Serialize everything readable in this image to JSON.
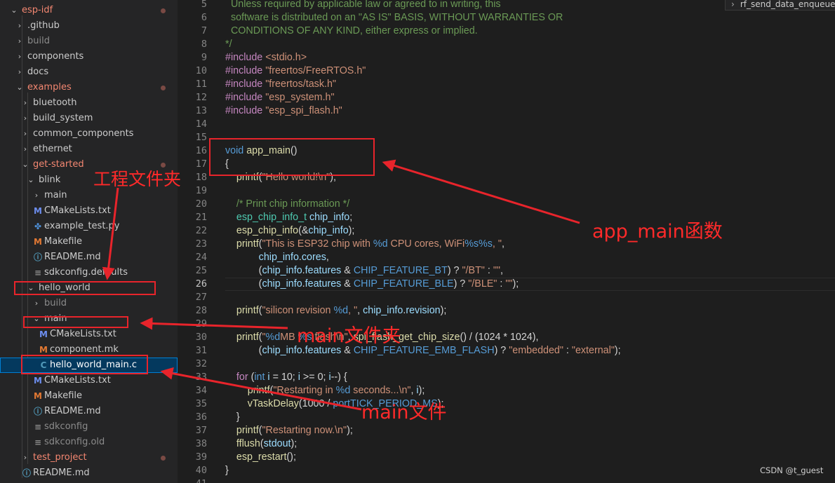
{
  "explorer": {
    "rows": [
      {
        "label": "esp-idf",
        "chevron": "⌄",
        "icon": "",
        "color": "#f48771",
        "modified": true,
        "indent": 0
      },
      {
        "label": ".github",
        "chevron": "›",
        "icon": "",
        "color": "#cccccc",
        "modified": false,
        "indent": 1
      },
      {
        "label": "build",
        "chevron": "›",
        "icon": "",
        "color": "#8b8b8b",
        "modified": false,
        "indent": 1
      },
      {
        "label": "components",
        "chevron": "›",
        "icon": "",
        "color": "#cccccc",
        "modified": false,
        "indent": 1
      },
      {
        "label": "docs",
        "chevron": "›",
        "icon": "",
        "color": "#cccccc",
        "modified": false,
        "indent": 1
      },
      {
        "label": "examples",
        "chevron": "⌄",
        "icon": "",
        "color": "#f48771",
        "modified": true,
        "indent": 1
      },
      {
        "label": "bluetooth",
        "chevron": "›",
        "icon": "",
        "color": "#cccccc",
        "modified": false,
        "indent": 2
      },
      {
        "label": "build_system",
        "chevron": "›",
        "icon": "",
        "color": "#cccccc",
        "modified": false,
        "indent": 2
      },
      {
        "label": "common_components",
        "chevron": "›",
        "icon": "",
        "color": "#cccccc",
        "modified": false,
        "indent": 2
      },
      {
        "label": "ethernet",
        "chevron": "›",
        "icon": "",
        "color": "#cccccc",
        "modified": false,
        "indent": 2
      },
      {
        "label": "get-started",
        "chevron": "⌄",
        "icon": "",
        "color": "#f48771",
        "modified": true,
        "indent": 2
      },
      {
        "label": "blink",
        "chevron": "⌄",
        "icon": "",
        "color": "#cccccc",
        "modified": false,
        "indent": 3
      },
      {
        "label": "main",
        "chevron": "›",
        "icon": "",
        "color": "#cccccc",
        "modified": false,
        "indent": 4
      },
      {
        "label": "CMakeLists.txt",
        "chevron": "",
        "icon": "M",
        "iconColor": "#6d8ef0",
        "color": "#cccccc",
        "modified": false,
        "indent": 4
      },
      {
        "label": "example_test.py",
        "chevron": "",
        "icon": "✤",
        "iconColor": "#4e8fd6",
        "color": "#cccccc",
        "modified": false,
        "indent": 4
      },
      {
        "label": "Makefile",
        "chevron": "",
        "icon": "M",
        "iconColor": "#e37933",
        "color": "#cccccc",
        "modified": false,
        "indent": 4
      },
      {
        "label": "README.md",
        "chevron": "",
        "icon": "ⓘ",
        "iconColor": "#519aba",
        "color": "#cccccc",
        "modified": false,
        "indent": 4
      },
      {
        "label": "sdkconfig.defaults",
        "chevron": "",
        "icon": "≡",
        "iconColor": "#8b8b8b",
        "color": "#cccccc",
        "modified": false,
        "indent": 4
      },
      {
        "label": "hello_world",
        "chevron": "⌄",
        "icon": "",
        "color": "#cccccc",
        "modified": false,
        "indent": 3
      },
      {
        "label": "build",
        "chevron": "›",
        "icon": "",
        "color": "#8b8b8b",
        "modified": false,
        "indent": 4
      },
      {
        "label": "main",
        "chevron": "⌄",
        "icon": "",
        "color": "#cccccc",
        "modified": false,
        "indent": 4
      },
      {
        "label": "CMakeLists.txt",
        "chevron": "",
        "icon": "M",
        "iconColor": "#6d8ef0",
        "color": "#cccccc",
        "modified": false,
        "indent": 5
      },
      {
        "label": "component.mk",
        "chevron": "",
        "icon": "M",
        "iconColor": "#e37933",
        "color": "#cccccc",
        "modified": false,
        "indent": 5
      },
      {
        "label": "hello_world_main.c",
        "chevron": "",
        "icon": "C",
        "iconColor": "#519aba",
        "color": "#ffffff",
        "modified": false,
        "indent": 5,
        "selected": true
      },
      {
        "label": "CMakeLists.txt",
        "chevron": "",
        "icon": "M",
        "iconColor": "#6d8ef0",
        "color": "#cccccc",
        "modified": false,
        "indent": 4
      },
      {
        "label": "Makefile",
        "chevron": "",
        "icon": "M",
        "iconColor": "#e37933",
        "color": "#cccccc",
        "modified": false,
        "indent": 4
      },
      {
        "label": "README.md",
        "chevron": "",
        "icon": "ⓘ",
        "iconColor": "#519aba",
        "color": "#cccccc",
        "modified": false,
        "indent": 4
      },
      {
        "label": "sdkconfig",
        "chevron": "",
        "icon": "≡",
        "iconColor": "#8b8b8b",
        "color": "#8b8b8b",
        "modified": false,
        "indent": 4
      },
      {
        "label": "sdkconfig.old",
        "chevron": "",
        "icon": "≡",
        "iconColor": "#8b8b8b",
        "color": "#8b8b8b",
        "modified": false,
        "indent": 4
      },
      {
        "label": "test_project",
        "chevron": "›",
        "icon": "",
        "color": "#f48771",
        "modified": true,
        "indent": 2
      },
      {
        "label": "README.md",
        "chevron": "",
        "icon": "ⓘ",
        "iconColor": "#519aba",
        "color": "#cccccc",
        "modified": false,
        "indent": 2
      }
    ]
  },
  "breadcrumb": {
    "label": "rf_send_data_enqueue"
  },
  "editor": {
    "current_line": 26,
    "lines": [
      {
        "n": 5,
        "tokens": [
          [
            "  Unless required by applicable law or agreed to in writing, this",
            "#6a9955"
          ]
        ]
      },
      {
        "n": 6,
        "tokens": [
          [
            "  software is distributed on an \"AS IS\" BASIS, WITHOUT WARRANTIES OR",
            "#6a9955"
          ]
        ]
      },
      {
        "n": 7,
        "tokens": [
          [
            "  CONDITIONS OF ANY KIND, either express or implied.",
            "#6a9955"
          ]
        ]
      },
      {
        "n": 8,
        "tokens": [
          [
            "*/",
            "#6a9955"
          ]
        ]
      },
      {
        "n": 9,
        "tokens": [
          [
            "#include ",
            "#c586c0"
          ],
          [
            "<stdio.h>",
            "#ce9178"
          ]
        ]
      },
      {
        "n": 10,
        "tokens": [
          [
            "#include ",
            "#c586c0"
          ],
          [
            "\"freertos/FreeRTOS.h\"",
            "#ce9178"
          ]
        ]
      },
      {
        "n": 11,
        "tokens": [
          [
            "#include ",
            "#c586c0"
          ],
          [
            "\"freertos/task.h\"",
            "#ce9178"
          ]
        ]
      },
      {
        "n": 12,
        "tokens": [
          [
            "#include ",
            "#c586c0"
          ],
          [
            "\"esp_system.h\"",
            "#ce9178"
          ]
        ]
      },
      {
        "n": 13,
        "tokens": [
          [
            "#include ",
            "#c586c0"
          ],
          [
            "\"esp_spi_flash.h\"",
            "#ce9178"
          ]
        ]
      },
      {
        "n": 14,
        "tokens": []
      },
      {
        "n": 15,
        "tokens": []
      },
      {
        "n": 16,
        "tokens": [
          [
            "void ",
            "#569cd6"
          ],
          [
            "app_main",
            "#dcdcaa"
          ],
          [
            "()",
            "#d4d4d4"
          ]
        ]
      },
      {
        "n": 17,
        "tokens": [
          [
            "{",
            "#d4d4d4"
          ]
        ]
      },
      {
        "n": 18,
        "tokens": [
          [
            "    ",
            "#d4d4d4"
          ],
          [
            "printf",
            "#dcdcaa"
          ],
          [
            "(",
            "#d4d4d4"
          ],
          [
            "\"Hello world!\\n\"",
            "#ce9178"
          ],
          [
            ");",
            "#d4d4d4"
          ]
        ]
      },
      {
        "n": 19,
        "tokens": []
      },
      {
        "n": 20,
        "tokens": [
          [
            "    /* Print chip information */",
            "#6a9955"
          ]
        ]
      },
      {
        "n": 21,
        "tokens": [
          [
            "    ",
            "#d4d4d4"
          ],
          [
            "esp_chip_info_t ",
            "#4ec9b0"
          ],
          [
            "chip_info",
            "#9cdcfe"
          ],
          [
            ";",
            "#d4d4d4"
          ]
        ]
      },
      {
        "n": 22,
        "tokens": [
          [
            "    ",
            "#d4d4d4"
          ],
          [
            "esp_chip_info",
            "#dcdcaa"
          ],
          [
            "(&",
            "#d4d4d4"
          ],
          [
            "chip_info",
            "#9cdcfe"
          ],
          [
            ");",
            "#d4d4d4"
          ]
        ]
      },
      {
        "n": 23,
        "tokens": [
          [
            "    ",
            "#d4d4d4"
          ],
          [
            "printf",
            "#dcdcaa"
          ],
          [
            "(",
            "#d4d4d4"
          ],
          [
            "\"This is ESP32 chip with ",
            "#ce9178"
          ],
          [
            "%d",
            "#569cd6"
          ],
          [
            " CPU cores, WiFi",
            "#ce9178"
          ],
          [
            "%s%s",
            "#569cd6"
          ],
          [
            ", \"",
            "#ce9178"
          ],
          [
            ",",
            "#d4d4d4"
          ]
        ]
      },
      {
        "n": 24,
        "tokens": [
          [
            "            ",
            "#d4d4d4"
          ],
          [
            "chip_info",
            "#9cdcfe"
          ],
          [
            ".",
            "#d4d4d4"
          ],
          [
            "cores",
            "#9cdcfe"
          ],
          [
            ",",
            "#d4d4d4"
          ]
        ]
      },
      {
        "n": 25,
        "tokens": [
          [
            "            (",
            "#d4d4d4"
          ],
          [
            "chip_info",
            "#9cdcfe"
          ],
          [
            ".",
            "#d4d4d4"
          ],
          [
            "features",
            "#9cdcfe"
          ],
          [
            " & ",
            "#d4d4d4"
          ],
          [
            "CHIP_FEATURE_BT",
            "#569cd6"
          ],
          [
            ") ? ",
            "#d4d4d4"
          ],
          [
            "\"/BT\"",
            "#ce9178"
          ],
          [
            " : ",
            "#d4d4d4"
          ],
          [
            "\"\"",
            "#ce9178"
          ],
          [
            ",",
            "#d4d4d4"
          ]
        ]
      },
      {
        "n": 26,
        "tokens": [
          [
            "            (",
            "#d4d4d4"
          ],
          [
            "chip_info",
            "#9cdcfe"
          ],
          [
            ".",
            "#d4d4d4"
          ],
          [
            "features",
            "#9cdcfe"
          ],
          [
            " & ",
            "#d4d4d4"
          ],
          [
            "CHIP_FEATURE_BLE",
            "#569cd6"
          ],
          [
            ") ? ",
            "#d4d4d4"
          ],
          [
            "\"/BLE\"",
            "#ce9178"
          ],
          [
            " : ",
            "#d4d4d4"
          ],
          [
            "\"\"",
            "#ce9178"
          ],
          [
            ");",
            "#d4d4d4"
          ]
        ]
      },
      {
        "n": 27,
        "tokens": []
      },
      {
        "n": 28,
        "tokens": [
          [
            "    ",
            "#d4d4d4"
          ],
          [
            "printf",
            "#dcdcaa"
          ],
          [
            "(",
            "#d4d4d4"
          ],
          [
            "\"silicon revision ",
            "#ce9178"
          ],
          [
            "%d",
            "#569cd6"
          ],
          [
            ", \"",
            "#ce9178"
          ],
          [
            ", ",
            "#d4d4d4"
          ],
          [
            "chip_info",
            "#9cdcfe"
          ],
          [
            ".",
            "#d4d4d4"
          ],
          [
            "revision",
            "#9cdcfe"
          ],
          [
            ");",
            "#d4d4d4"
          ]
        ]
      },
      {
        "n": 29,
        "tokens": []
      },
      {
        "n": 30,
        "tokens": [
          [
            "    ",
            "#d4d4d4"
          ],
          [
            "printf",
            "#dcdcaa"
          ],
          [
            "(",
            "#d4d4d4"
          ],
          [
            "\"",
            "#ce9178"
          ],
          [
            "%d",
            "#569cd6"
          ],
          [
            "MB ",
            "#ce9178"
          ],
          [
            "%s",
            "#569cd6"
          ],
          [
            " flash\\n\"",
            "#ce9178"
          ],
          [
            ", ",
            "#d4d4d4"
          ],
          [
            "spi_flash_get_chip_size",
            "#dcdcaa"
          ],
          [
            "() / (1024 * 1024),",
            "#d4d4d4"
          ]
        ]
      },
      {
        "n": 31,
        "tokens": [
          [
            "            (",
            "#d4d4d4"
          ],
          [
            "chip_info",
            "#9cdcfe"
          ],
          [
            ".",
            "#d4d4d4"
          ],
          [
            "features",
            "#9cdcfe"
          ],
          [
            " & ",
            "#d4d4d4"
          ],
          [
            "CHIP_FEATURE_EMB_FLASH",
            "#569cd6"
          ],
          [
            ") ? ",
            "#d4d4d4"
          ],
          [
            "\"embedded\"",
            "#ce9178"
          ],
          [
            " : ",
            "#d4d4d4"
          ],
          [
            "\"external\"",
            "#ce9178"
          ],
          [
            ");",
            "#d4d4d4"
          ]
        ]
      },
      {
        "n": 32,
        "tokens": []
      },
      {
        "n": 33,
        "tokens": [
          [
            "    ",
            "#d4d4d4"
          ],
          [
            "for ",
            "#c586c0"
          ],
          [
            "(",
            "#d4d4d4"
          ],
          [
            "int ",
            "#569cd6"
          ],
          [
            "i",
            "#9cdcfe"
          ],
          [
            " = 10; ",
            "#d4d4d4"
          ],
          [
            "i",
            "#9cdcfe"
          ],
          [
            " >= 0; ",
            "#d4d4d4"
          ],
          [
            "i",
            "#9cdcfe"
          ],
          [
            "--) {",
            "#d4d4d4"
          ]
        ]
      },
      {
        "n": 34,
        "tokens": [
          [
            "        ",
            "#d4d4d4"
          ],
          [
            "printf",
            "#dcdcaa"
          ],
          [
            "(",
            "#d4d4d4"
          ],
          [
            "\"Restarting in ",
            "#ce9178"
          ],
          [
            "%d",
            "#569cd6"
          ],
          [
            " seconds...\\n\"",
            "#ce9178"
          ],
          [
            ", ",
            "#d4d4d4"
          ],
          [
            "i",
            "#9cdcfe"
          ],
          [
            ");",
            "#d4d4d4"
          ]
        ]
      },
      {
        "n": 35,
        "tokens": [
          [
            "        ",
            "#d4d4d4"
          ],
          [
            "vTaskDelay",
            "#dcdcaa"
          ],
          [
            "(1000 / ",
            "#d4d4d4"
          ],
          [
            "portTICK_PERIOD_MS",
            "#569cd6"
          ],
          [
            ");",
            "#d4d4d4"
          ]
        ]
      },
      {
        "n": 36,
        "tokens": [
          [
            "    }",
            "#d4d4d4"
          ]
        ]
      },
      {
        "n": 37,
        "tokens": [
          [
            "    ",
            "#d4d4d4"
          ],
          [
            "printf",
            "#dcdcaa"
          ],
          [
            "(",
            "#d4d4d4"
          ],
          [
            "\"Restarting now.\\n\"",
            "#ce9178"
          ],
          [
            ");",
            "#d4d4d4"
          ]
        ]
      },
      {
        "n": 38,
        "tokens": [
          [
            "    ",
            "#d4d4d4"
          ],
          [
            "fflush",
            "#dcdcaa"
          ],
          [
            "(",
            "#d4d4d4"
          ],
          [
            "stdout",
            "#9cdcfe"
          ],
          [
            ");",
            "#d4d4d4"
          ]
        ]
      },
      {
        "n": 39,
        "tokens": [
          [
            "    ",
            "#d4d4d4"
          ],
          [
            "esp_restart",
            "#dcdcaa"
          ],
          [
            "();",
            "#d4d4d4"
          ]
        ]
      },
      {
        "n": 40,
        "tokens": [
          [
            "}",
            "#d4d4d4"
          ]
        ]
      },
      {
        "n": 41,
        "tokens": []
      }
    ]
  },
  "annotations": {
    "project_folder": "工程文件夹",
    "app_main_fn": "app_main函数",
    "main_folder": "main文件夹",
    "main_file": "main文件",
    "color": "#e8242b"
  },
  "watermark": "CSDN @t_guest"
}
